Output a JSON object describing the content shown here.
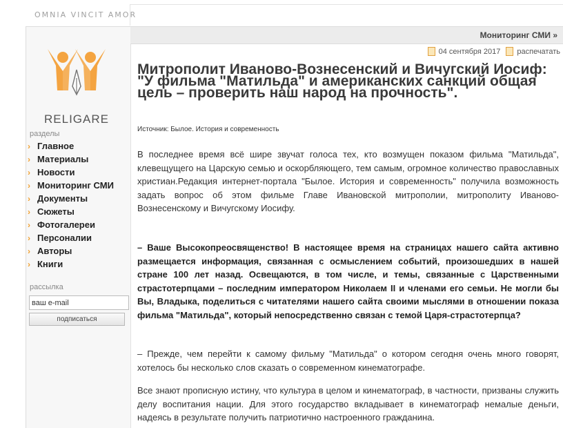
{
  "header": {
    "motto": "OMNIA VINCIT AMOR"
  },
  "logo": {
    "text": "RELIGARE"
  },
  "sidebar": {
    "sections_label": "разделы",
    "items": [
      {
        "label": "Главное"
      },
      {
        "label": "Материалы"
      },
      {
        "label": "Новости"
      },
      {
        "label": "Мониторинг СМИ"
      },
      {
        "label": "Документы"
      },
      {
        "label": "Сюжеты"
      },
      {
        "label": "Фотогалереи"
      },
      {
        "label": "Персоналии"
      },
      {
        "label": "Авторы"
      },
      {
        "label": "Книги"
      }
    ],
    "newsletter_label": "рассылка",
    "email_value": "ваш e-mail",
    "subscribe_label": "подписаться"
  },
  "breadcrumb": {
    "label": "Мониторинг СМИ »"
  },
  "article": {
    "date": "04 сентября 2017",
    "print_label": "распечатать",
    "title": "Митрополит Иваново-Вознесенский и Вичугский Иосиф: \"У фильма \"Матильда\" и американских санкций общая цель – проверить наш народ на прочность\".",
    "source": "Источник: Былое. История и современность",
    "intro": "В последнее время всё шире звучат голоса тех, кто возмущен показом фильма \"Матильда\", клевещущего на Царскую семью и оскорбляющего, тем самым, огромное количество православных христиан.Редакция интернет-портала \"Былое. История и современность\" получила возможность задать вопрос об этом фильме Главе Ивановской митрополии, митрополиту Иваново-Вознесенскому и Вичугскому Иосифу.",
    "question": "– Ваше Высокопреосвященство! В настоящее время на страницах нашего сайта активно размещается информация, связанная с осмыслением событий, произошедших в нашей стране 100 лет назад. Освещаются, в том числе, и темы, связанные с Царственными страстотерпцами – последним императором Николаем II и членами его семьи. Не могли бы Вы, Владыка, поделиться с читателями нашего сайта своими мыслями в отношении показа фильма \"Матильда\", который непосредственно связан с темой Царя-страстотерпца?",
    "answer1": "– Прежде, чем перейти к самому фильму \"Матильда\" о котором сегодня очень много говорят, хотелось бы несколько слов сказать о современном кинематографе.",
    "answer2": "Все знают прописную истину, что культура в целом и кинематограф, в частности, призваны служить делу воспитания нации. Для этого государство вкладывает в кинематограф немалые деньги, надеясь в результате получить патриотично настроенного гражданина."
  },
  "colors": {
    "accent": "#f0a030",
    "logo_orange": "#f4a441",
    "sidebar_bg": "#f7f7f7"
  }
}
